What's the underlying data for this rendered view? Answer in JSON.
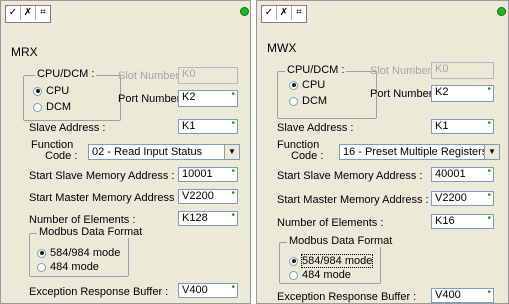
{
  "left": {
    "toolbar": [
      "✓",
      "✗",
      "⌗"
    ],
    "title": "MRX",
    "cpu_dcm_group": "CPU/DCM :",
    "cpu_option": "CPU",
    "dcm_option": "DCM",
    "slot_label": "Slot Number :",
    "slot_value": "K0",
    "port_label": "Port Number :",
    "port_value": "K2",
    "slave_label": "Slave Address :",
    "slave_value": "K1",
    "function_label_1": "Function",
    "function_label_2": "Code :",
    "function_value": "02 - Read Input Status",
    "start_slave_label": "Start Slave Memory Address :",
    "start_slave_value": "10001",
    "start_master_label": "Start Master Memory Address :",
    "start_master_value": "V2200",
    "num_elements_label": "Number of Elements :",
    "num_elements_value": "K128",
    "modbus_group": "Modbus Data Format",
    "mode_584": "584/984 mode",
    "mode_484": "484 mode",
    "exception_label": "Exception Response Buffer :",
    "exception_value": "V400"
  },
  "right": {
    "toolbar": [
      "✓",
      "✗",
      "⌗"
    ],
    "title": "MWX",
    "cpu_dcm_group": "CPU/DCM :",
    "cpu_option": "CPU",
    "dcm_option": "DCM",
    "slot_label": "Slot Number :",
    "slot_value": "K0",
    "port_label": "Port Number :",
    "port_value": "K2",
    "slave_label": "Slave Address :",
    "slave_value": "K1",
    "function_label_1": "Function",
    "function_label_2": "Code :",
    "function_value": "16 - Preset Multiple Registers",
    "start_slave_label": "Start Slave Memory Address :",
    "start_slave_value": "40001",
    "start_master_label": "Start Master Memory Address :",
    "start_master_value": "V2200",
    "num_elements_label": "Number of Elements :",
    "num_elements_value": "K16",
    "modbus_group": "Modbus Data Format",
    "mode_584": "584/984 mode",
    "mode_484": "484 mode",
    "exception_label": "Exception Response Buffer :",
    "exception_value": "V400"
  },
  "status_mark": "•",
  "icons": {
    "status_led": "green-led-icon",
    "dropdown": "chevron-down-icon"
  },
  "colors": {
    "panel_bg": "#ece9d8",
    "led": "#23b323",
    "field_border": "#7f9db9",
    "disabled_text": "#a6a6a6"
  }
}
